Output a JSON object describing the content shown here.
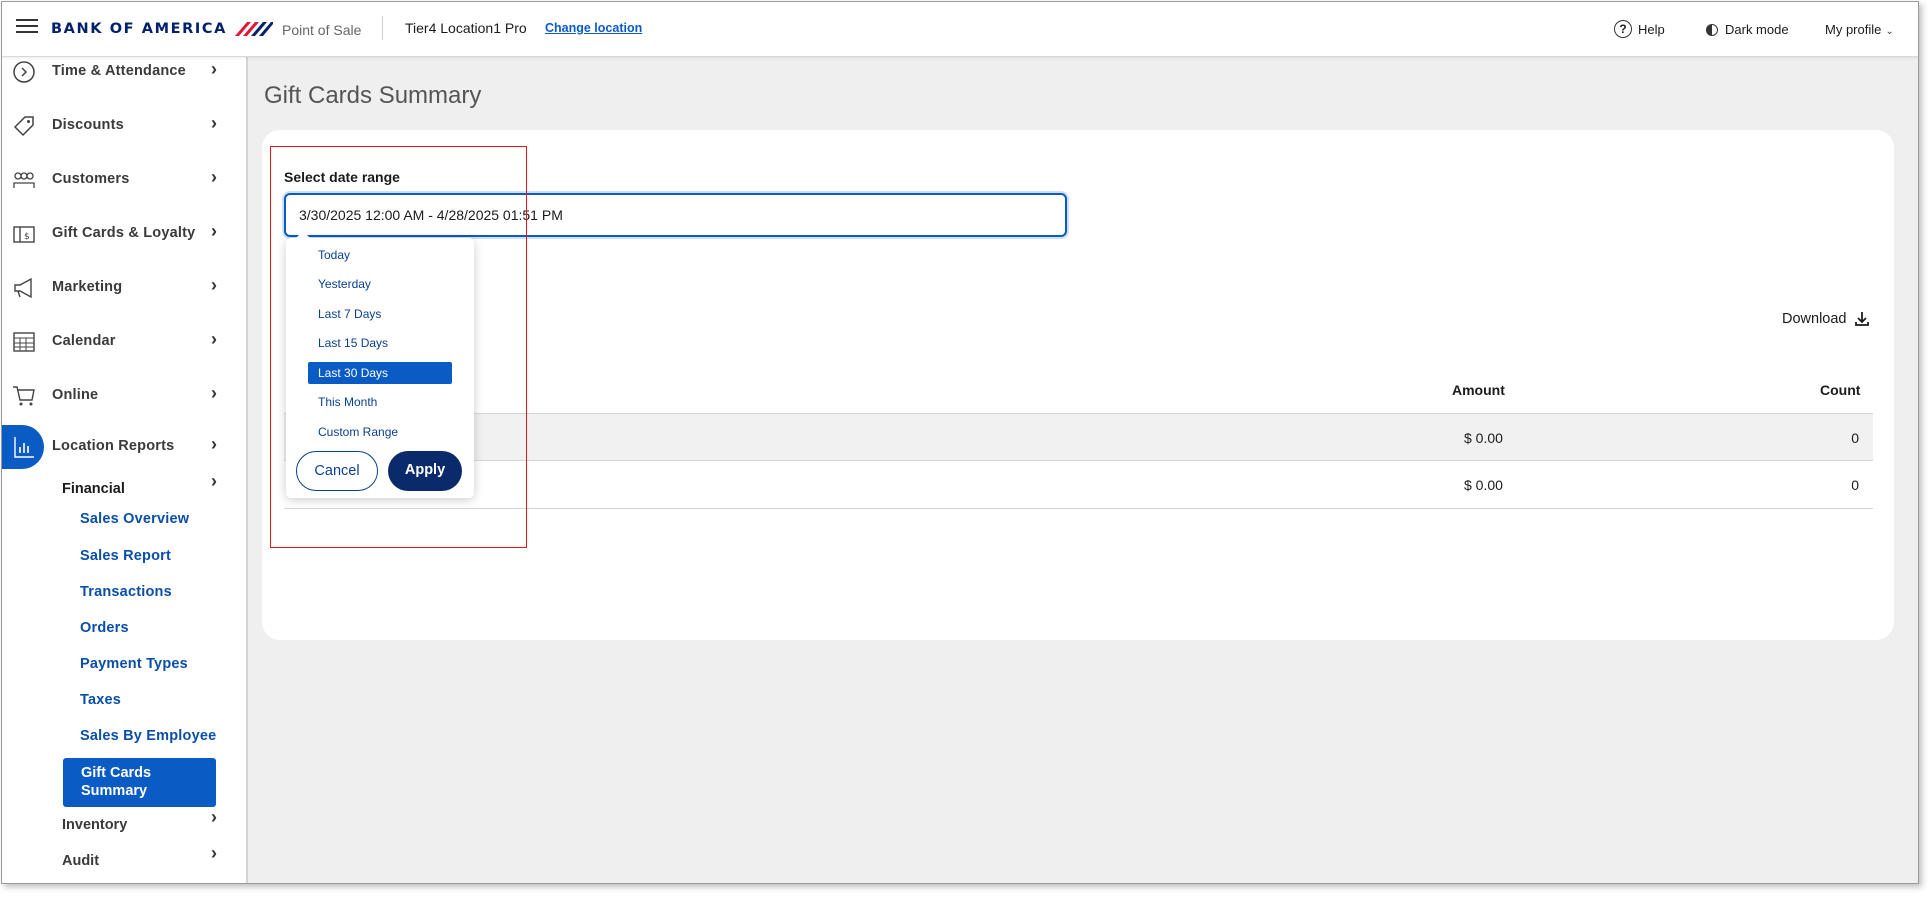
{
  "header": {
    "brand": "BANK OF AMERICA",
    "app_name": "Point of Sale",
    "location_name": "Tier4 Location1 Pro",
    "change_location": "Change location",
    "help": "Help",
    "dark_mode": "Dark mode",
    "profile": "My profile"
  },
  "sidebar": {
    "items": [
      {
        "label": "Time & Attendance",
        "icon": "clock-icon"
      },
      {
        "label": "Discounts",
        "icon": "tag-icon"
      },
      {
        "label": "Customers",
        "icon": "people-icon"
      },
      {
        "label": "Gift Cards & Loyalty",
        "icon": "gift-card-icon"
      },
      {
        "label": "Marketing",
        "icon": "megaphone-icon"
      },
      {
        "label": "Calendar",
        "icon": "calendar-icon"
      },
      {
        "label": "Online",
        "icon": "cart-icon"
      },
      {
        "label": "Location Reports",
        "icon": "bar-chart-icon"
      }
    ],
    "financial": "Financial",
    "financial_links": [
      "Sales Overview",
      "Sales Report",
      "Transactions",
      "Orders",
      "Payment Types",
      "Taxes",
      "Sales By Employee"
    ],
    "active_link": "Gift Cards Summary",
    "inventory": "Inventory",
    "audit": "Audit"
  },
  "main": {
    "title": "Gift Cards Summary",
    "range_label": "Select date range",
    "range_value": "3/30/2025 12:00 AM - 4/28/2025 01:51 PM",
    "download": "Download",
    "columns": {
      "amount": "Amount",
      "count": "Count"
    },
    "rows": [
      {
        "amount": "$ 0.00",
        "count": "0"
      },
      {
        "amount": "$ 0.00",
        "count": "0"
      }
    ]
  },
  "dropdown": {
    "options": [
      "Today",
      "Yesterday",
      "Last 7 Days",
      "Last 15 Days",
      "Last 30 Days",
      "This Month",
      "Custom Range"
    ],
    "selected": "Last 30 Days",
    "cancel": "Cancel",
    "apply": "Apply"
  },
  "colors": {
    "accent": "#0a5bc4",
    "brand": "#012169",
    "apply_button": "#0a2a6b",
    "highlight": "#e0191b"
  }
}
